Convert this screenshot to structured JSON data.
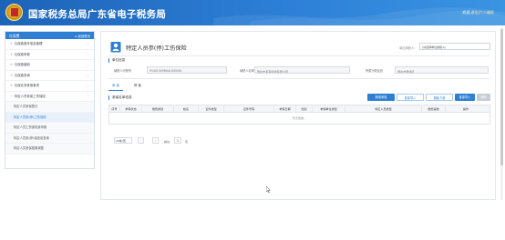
{
  "header": {
    "site_title": "国家税务总局广东省电子税务局",
    "welcome_prefix": "欢迎,",
    "welcome_user": "退出|个人缴款"
  },
  "sidebar": {
    "title": "社保费",
    "back_label": "返回首页",
    "items": [
      {
        "label": "社保费基本信息管理",
        "expanded": false
      },
      {
        "label": "社保费申报",
        "expanded": false
      },
      {
        "label": "社保费缴纳",
        "expanded": false
      },
      {
        "label": "社保费查询",
        "expanded": false
      },
      {
        "label": "社保业务其他事项",
        "expanded": false
      },
      {
        "label": "特定人员参保工伤保险",
        "expanded": true
      }
    ],
    "subitems": [
      {
        "label": "特定人员参保登记",
        "active": false
      },
      {
        "label": "特定人员参(停)工伤保险",
        "active": true
      },
      {
        "label": "特定人员工伤保险费申报",
        "active": false
      },
      {
        "label": "特定人员参(停)保信息查询",
        "active": false
      },
      {
        "label": "特定人员参保基数调整",
        "active": false
      }
    ]
  },
  "main": {
    "page_title": "特定人员参(停)工伤保险",
    "taxpayer_label": "单位纳税人:",
    "taxpayer_value": "(请选择单位纳税人)",
    "unit_info_title": "单位信息",
    "fields": {
      "reg_no_label": "纳税人识别号",
      "reg_no_value": "91441300MA4UXXXXX",
      "unit_name_label": "纳税人名称",
      "unit_name_value": "惠州市某某科技有限公司",
      "district_label": "所属行政区划",
      "district_value": "惠州市惠城区"
    },
    "tabs": [
      {
        "label": "参 保",
        "active": true
      },
      {
        "label": "停 保",
        "active": false
      }
    ],
    "list_title": "参保名单信息",
    "buttons": {
      "add": "新增参保",
      "import": "批量导入",
      "download": "模板下载",
      "batch_import": "批量导入",
      "delete": "删除"
    },
    "columns": [
      "序号",
      "参保状态",
      "缴费类别",
      "姓名",
      "证件类型",
      "证件号码",
      "参保日期",
      "性别",
      "参保单位类型",
      "特定人员类型",
      "缴费基数",
      "操作"
    ],
    "empty_text": "暂无数据。",
    "pager": {
      "page_size": "10条/页",
      "total_label": "共0条",
      "page_prefix": "前往",
      "page_value": "1",
      "page_suffix": "页"
    }
  }
}
